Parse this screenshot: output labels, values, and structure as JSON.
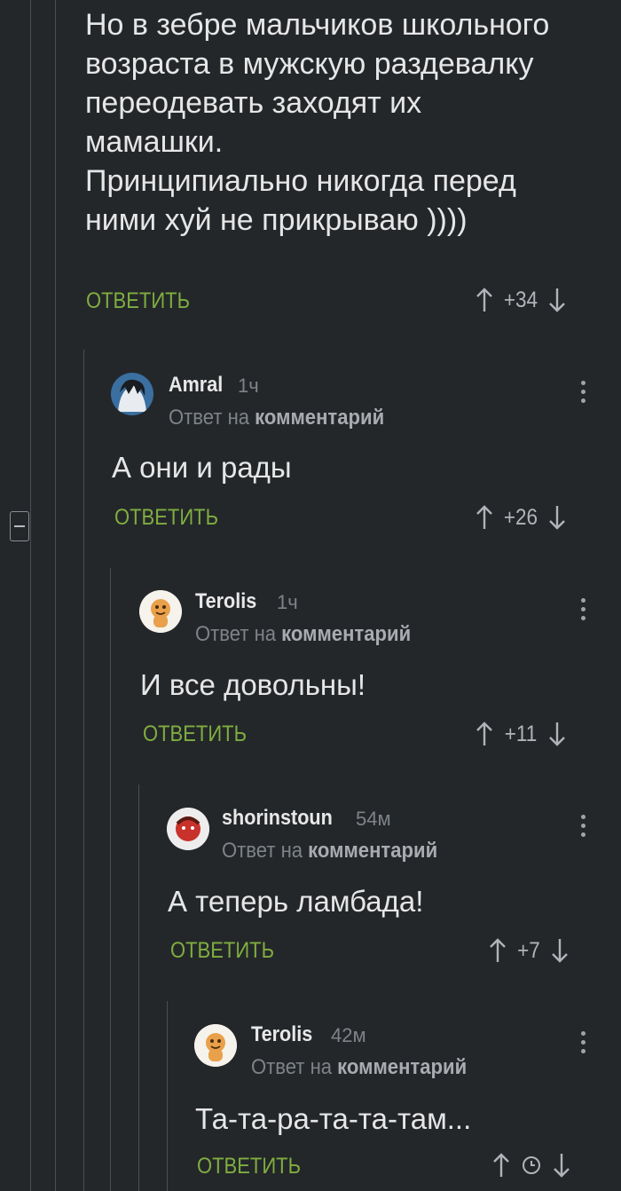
{
  "top_comment": {
    "text": "Но в зебре мальчиков школьного\nвозраста в мужскую раздевалку\nпереодевать заходят их\nмамашки.\nПринципиально никогда перед\nними хуй не прикрываю ))))",
    "reply_label": "ОТВЕТИТЬ",
    "score": "+34"
  },
  "replies": [
    {
      "username": "Amral",
      "time": "1ч",
      "reply_to_prefix": "Ответ на",
      "reply_to_link": "комментарий",
      "text": "А они и рады",
      "reply_label": "ОТВЕТИТЬ",
      "score": "+26"
    },
    {
      "username": "Terolis",
      "time": "1ч",
      "reply_to_prefix": "Ответ на",
      "reply_to_link": "комментарий",
      "text": "И все довольны!",
      "reply_label": "ОТВЕТИТЬ",
      "score": "+11"
    },
    {
      "username": "shorinstoun",
      "time": "54м",
      "reply_to_prefix": "Ответ на",
      "reply_to_link": "комментарий",
      "text": "А теперь ламбада!",
      "reply_label": "ОТВЕТИТЬ",
      "score": "+7"
    },
    {
      "username": "Terolis",
      "time": "42м",
      "reply_to_prefix": "Ответ на",
      "reply_to_link": "комментарий",
      "text": "Та-та-ра-та-та-там...",
      "reply_label": "ОТВЕТИТЬ",
      "score_icon": "clock-icon"
    }
  ],
  "colors": {
    "background": "#24272a",
    "reply_link": "#7fae3f",
    "thread_line": "#4a4e52"
  }
}
